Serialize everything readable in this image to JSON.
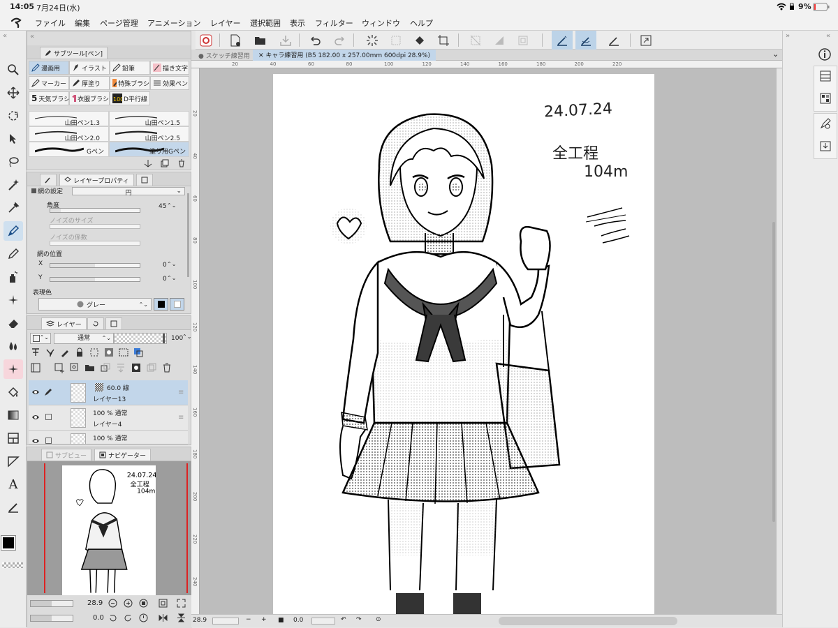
{
  "status": {
    "time": "14:05",
    "date": "7月24日(水)",
    "battery": "9%"
  },
  "menu": [
    "ファイル",
    "編集",
    "ページ管理",
    "アニメーション",
    "レイヤー",
    "選択範囲",
    "表示",
    "フィルター",
    "ウィンドウ",
    "ヘルプ"
  ],
  "subtool": {
    "tab_label": "サブツール[ペン]",
    "groups": [
      "漫画用",
      "イラスト",
      "鉛筆",
      "描き文字",
      "マーカー",
      "厚塗り",
      "特殊ブラシ",
      "効果ペン",
      "天気ブラシ",
      "衣服ブラシ",
      "D平行線"
    ],
    "brushes": [
      "山田ペン1.3",
      "山田ペン1.5",
      "山田ペン2.0",
      "山田ペン2.5",
      "Gペン",
      "塗り用Gペン"
    ]
  },
  "props": {
    "tab_label": "レイヤープロパティ",
    "section": "網の設定",
    "shape_value": "円",
    "angle_label": "角度",
    "angle_value": "45",
    "noise_size_label": "ノイズのサイズ",
    "noise_factor_label": "ノイズの係数",
    "position_label": "網の位置",
    "x_label": "X",
    "x_value": "0",
    "y_label": "Y",
    "y_value": "0",
    "expr_label": "表現色",
    "color_mode": "グレー"
  },
  "layers": {
    "tab_label": "レイヤー",
    "blend": "通常",
    "opacity": "100",
    "items": [
      {
        "name": "レイヤー13",
        "info": "60.0 線",
        "active": true
      },
      {
        "name": "レイヤー4",
        "info": "100 % 通常",
        "active": false
      },
      {
        "name": "",
        "info": "100 % 通常",
        "active": false
      }
    ]
  },
  "navigator": {
    "tab_sub": "サブビュー",
    "tab_nav": "ナビゲーター",
    "zoom": "28.9",
    "rotation": "0.0"
  },
  "document": {
    "tab_inactive": "スケッチ練習用",
    "tab_active": "キャラ練習用 (B5 182.00 x 257.00mm 600dpi 28.9%)"
  },
  "ruler": {
    "h_ticks": [
      "20",
      "40",
      "60",
      "80",
      "100",
      "120",
      "140",
      "160",
      "180",
      "200",
      "220"
    ],
    "v_ticks": [
      "20",
      "40",
      "60",
      "80",
      "100",
      "120",
      "140",
      "160",
      "180",
      "200",
      "220",
      "240"
    ]
  },
  "canvas_notes": {
    "date": "24.07.24",
    "line1": "全工程",
    "line2": "104m"
  },
  "bottom": {
    "zoom": "28.9",
    "rotation": "0.0"
  },
  "colors": {
    "accent": "#c2d6ea",
    "main_color": "#000000",
    "sub_color": "#ffffff"
  }
}
